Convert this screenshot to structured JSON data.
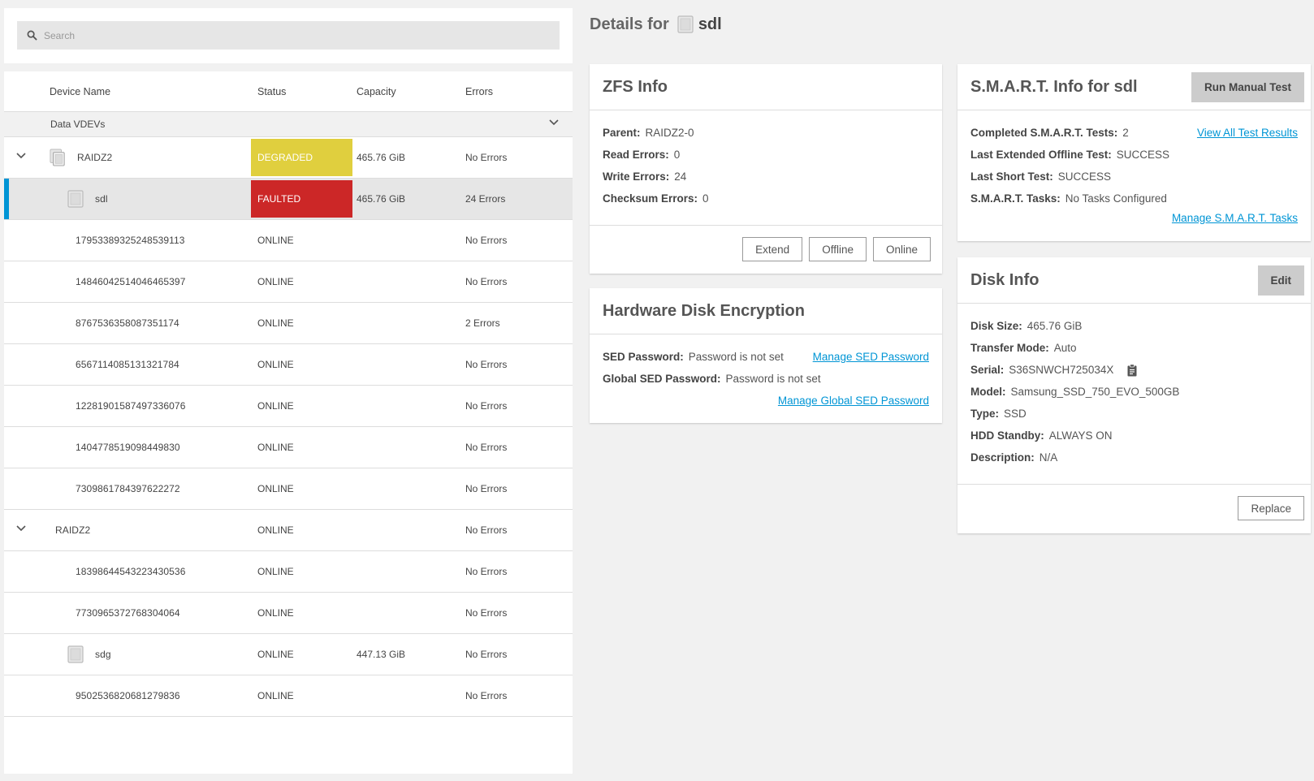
{
  "search": {
    "placeholder": "Search"
  },
  "table": {
    "headers": {
      "name": "Device Name",
      "status": "Status",
      "capacity": "Capacity",
      "errors": "Errors"
    },
    "group_label": "Data VDEVs",
    "rows": [
      {
        "name": "RAIDZ2",
        "status": "DEGRADED",
        "capacity": "465.76 GiB",
        "errors": "No Errors"
      },
      {
        "name": "sdl",
        "status": "FAULTED",
        "capacity": "465.76 GiB",
        "errors": "24 Errors"
      },
      {
        "name": "17953389325248539113",
        "status": "ONLINE",
        "capacity": "",
        "errors": "No Errors"
      },
      {
        "name": "14846042514046465397",
        "status": "ONLINE",
        "capacity": "",
        "errors": "No Errors"
      },
      {
        "name": "8767536358087351174",
        "status": "ONLINE",
        "capacity": "",
        "errors": "2 Errors"
      },
      {
        "name": "6567114085131321784",
        "status": "ONLINE",
        "capacity": "",
        "errors": "No Errors"
      },
      {
        "name": "12281901587497336076",
        "status": "ONLINE",
        "capacity": "",
        "errors": "No Errors"
      },
      {
        "name": "1404778519098449830",
        "status": "ONLINE",
        "capacity": "",
        "errors": "No Errors"
      },
      {
        "name": "7309861784397622272",
        "status": "ONLINE",
        "capacity": "",
        "errors": "No Errors"
      },
      {
        "name": "RAIDZ2",
        "status": "ONLINE",
        "capacity": "",
        "errors": "No Errors"
      },
      {
        "name": "18398644543223430536",
        "status": "ONLINE",
        "capacity": "",
        "errors": "No Errors"
      },
      {
        "name": "7730965372768304064",
        "status": "ONLINE",
        "capacity": "",
        "errors": "No Errors"
      },
      {
        "name": "sdg",
        "status": "ONLINE",
        "capacity": "447.13 GiB",
        "errors": "No Errors"
      },
      {
        "name": "9502536820681279836",
        "status": "ONLINE",
        "capacity": "",
        "errors": "No Errors"
      }
    ]
  },
  "details": {
    "prefix": "Details for",
    "disk": "sdl"
  },
  "zfs": {
    "title": "ZFS Info",
    "fields": [
      {
        "k": "Parent:",
        "v": "RAIDZ2-0"
      },
      {
        "k": "Read Errors:",
        "v": "0"
      },
      {
        "k": "Write Errors:",
        "v": "24"
      },
      {
        "k": "Checksum Errors:",
        "v": "0"
      }
    ],
    "buttons": {
      "extend": "Extend",
      "offline": "Offline",
      "online": "Online"
    }
  },
  "encryption": {
    "title": "Hardware Disk Encryption",
    "sed_k": "SED Password:",
    "sed_v": "Password is not set",
    "global_k": "Global SED Password:",
    "global_v": "Password is not set",
    "manage_sed": "Manage SED Password",
    "manage_global": "Manage Global SED Password"
  },
  "smart": {
    "title": "S.M.A.R.T. Info for sdl",
    "run_button": "Run Manual Test",
    "fields": [
      {
        "k": "Completed S.M.A.R.T. Tests:",
        "v": "2"
      },
      {
        "k": "Last Extended Offline Test:",
        "v": "SUCCESS"
      },
      {
        "k": "Last Short Test:",
        "v": "SUCCESS"
      },
      {
        "k": "S.M.A.R.T. Tasks:",
        "v": "No Tasks Configured"
      }
    ],
    "view_all": "View All Test Results",
    "manage_tasks": "Manage S.M.A.R.T. Tasks"
  },
  "disk": {
    "title": "Disk Info",
    "edit_button": "Edit",
    "fields": [
      {
        "k": "Disk Size:",
        "v": "465.76 GiB"
      },
      {
        "k": "Transfer Mode:",
        "v": "Auto"
      },
      {
        "k": "Serial:",
        "v": "S36SNWCH725034X"
      },
      {
        "k": "Model:",
        "v": "Samsung_SSD_750_EVO_500GB"
      },
      {
        "k": "Type:",
        "v": "SSD"
      },
      {
        "k": "HDD Standby:",
        "v": "ALWAYS ON"
      },
      {
        "k": "Description:",
        "v": "N/A"
      }
    ],
    "replace_button": "Replace"
  },
  "colors": {
    "accent": "#0095d5",
    "degraded": "#e0cf3e",
    "faulted": "#cc2727"
  }
}
